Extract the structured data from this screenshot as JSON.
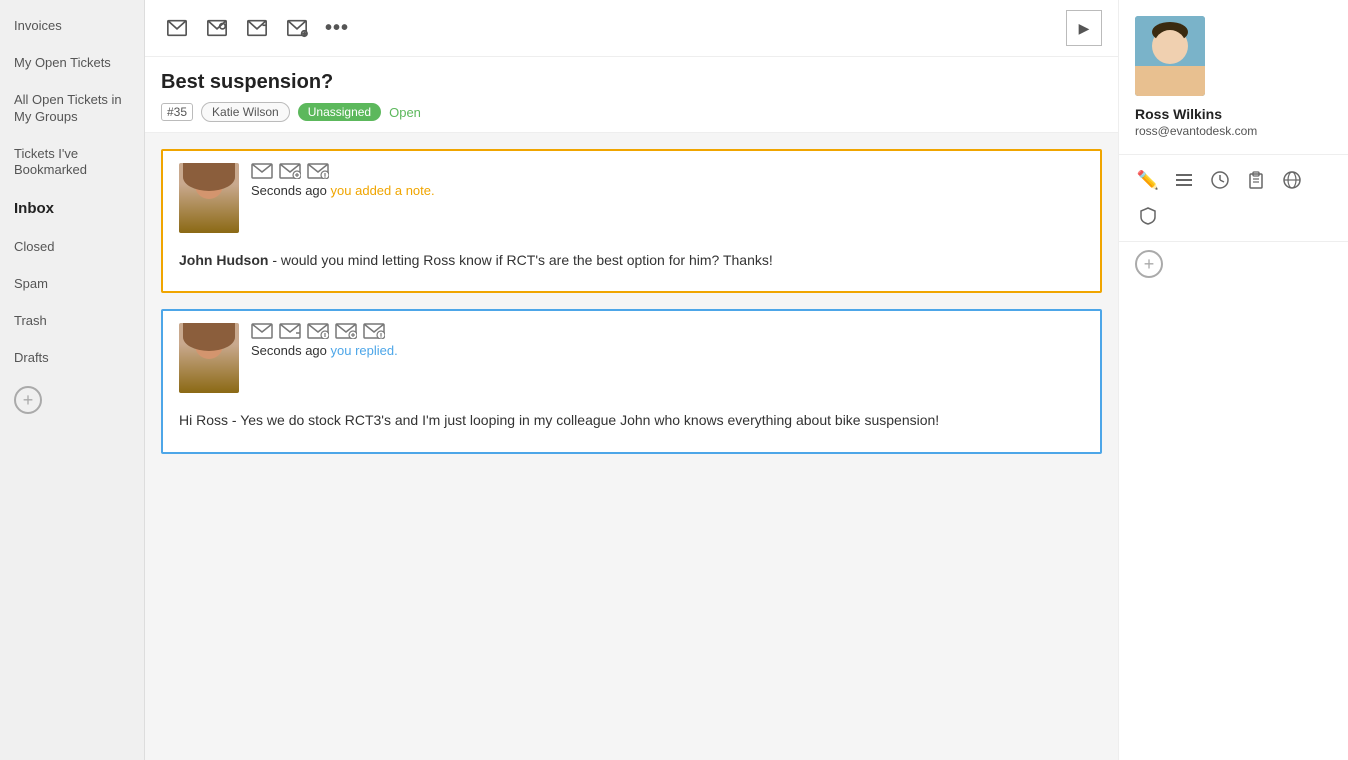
{
  "sidebar": {
    "items": [
      {
        "label": "Invoices",
        "id": "invoices",
        "active": false
      },
      {
        "label": "My Open Tickets",
        "id": "my-open-tickets",
        "active": false
      },
      {
        "label": "All Open Tickets in My Groups",
        "id": "all-open-tickets",
        "active": false
      },
      {
        "label": "Tickets I've Bookmarked",
        "id": "bookmarked",
        "active": false
      },
      {
        "label": "Inbox",
        "id": "inbox",
        "active": true
      },
      {
        "label": "Closed",
        "id": "closed",
        "active": false
      },
      {
        "label": "Spam",
        "id": "spam",
        "active": false
      },
      {
        "label": "Trash",
        "id": "trash",
        "active": false
      },
      {
        "label": "Drafts",
        "id": "drafts",
        "active": false
      }
    ],
    "add_label": "+"
  },
  "toolbar": {
    "play_label": "▶"
  },
  "ticket": {
    "title": "Best suspension?",
    "number": "#35",
    "person": "Katie Wilson",
    "status_unassigned": "Unassigned",
    "status_open": "Open"
  },
  "messages": [
    {
      "id": "note",
      "border_type": "note",
      "time_prefix": "Seconds ago",
      "time_action": "you added a note.",
      "action_color": "orange",
      "body_html": "<strong>John Hudson</strong> - would you mind letting Ross know if RCT's are the best option for him? Thanks!"
    },
    {
      "id": "reply",
      "border_type": "reply",
      "time_prefix": "Seconds ago",
      "time_action": "you replied.",
      "action_color": "blue",
      "body_html": "Hi Ross - Yes we do stock RCT3's and I'm just looping in my colleague John who knows everything about bike suspension!"
    }
  ],
  "contact": {
    "name": "Ross Wilkins",
    "email": "ross@evantodesk.com"
  },
  "icons": {
    "edit": "✏️",
    "list": "☰",
    "clock": "🕐",
    "clipboard": "📋",
    "globe": "🌐",
    "shield": "🛡",
    "add_circle": "+",
    "more": "•••",
    "play": "▶"
  }
}
